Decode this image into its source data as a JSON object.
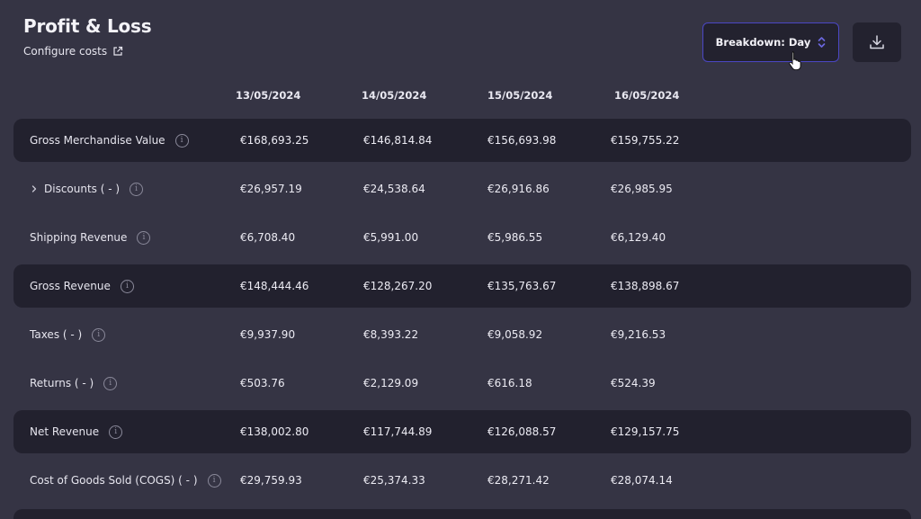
{
  "header": {
    "title": "Profit & Loss",
    "configure_label": "Configure costs",
    "breakdown_label": "Breakdown: Day"
  },
  "icons": {
    "external_link": "external-link-icon",
    "updown": "chevron-up-down-icon",
    "download": "download-icon",
    "info": "info-icon",
    "expand": "chevron-right-icon"
  },
  "colors": {
    "background": "#353444",
    "row_highlight": "#22212e",
    "accent_border": "#4b47c4"
  },
  "table": {
    "dates": [
      "13/05/2024",
      "14/05/2024",
      "15/05/2024",
      "16/05/2024"
    ],
    "rows": [
      {
        "label": "Gross Merchandise Value",
        "values": [
          "€168,693.25",
          "€146,814.84",
          "€156,693.98",
          "€159,755.22"
        ]
      },
      {
        "label": "Discounts ( - )",
        "values": [
          "€26,957.19",
          "€24,538.64",
          "€26,916.86",
          "€26,985.95"
        ]
      },
      {
        "label": "Shipping Revenue",
        "values": [
          "€6,708.40",
          "€5,991.00",
          "€5,986.55",
          "€6,129.40"
        ]
      },
      {
        "label": "Gross Revenue",
        "values": [
          "€148,444.46",
          "€128,267.20",
          "€135,763.67",
          "€138,898.67"
        ]
      },
      {
        "label": "Taxes ( - )",
        "values": [
          "€9,937.90",
          "€8,393.22",
          "€9,058.92",
          "€9,216.53"
        ]
      },
      {
        "label": "Returns ( - )",
        "values": [
          "€503.76",
          "€2,129.09",
          "€616.18",
          "€524.39"
        ]
      },
      {
        "label": "Net Revenue",
        "values": [
          "€138,002.80",
          "€117,744.89",
          "€126,088.57",
          "€129,157.75"
        ]
      },
      {
        "label": "Cost of Goods Sold (COGS) ( - )",
        "values": [
          "€29,759.93",
          "€25,374.33",
          "€28,271.42",
          "€28,074.14"
        ]
      }
    ]
  }
}
